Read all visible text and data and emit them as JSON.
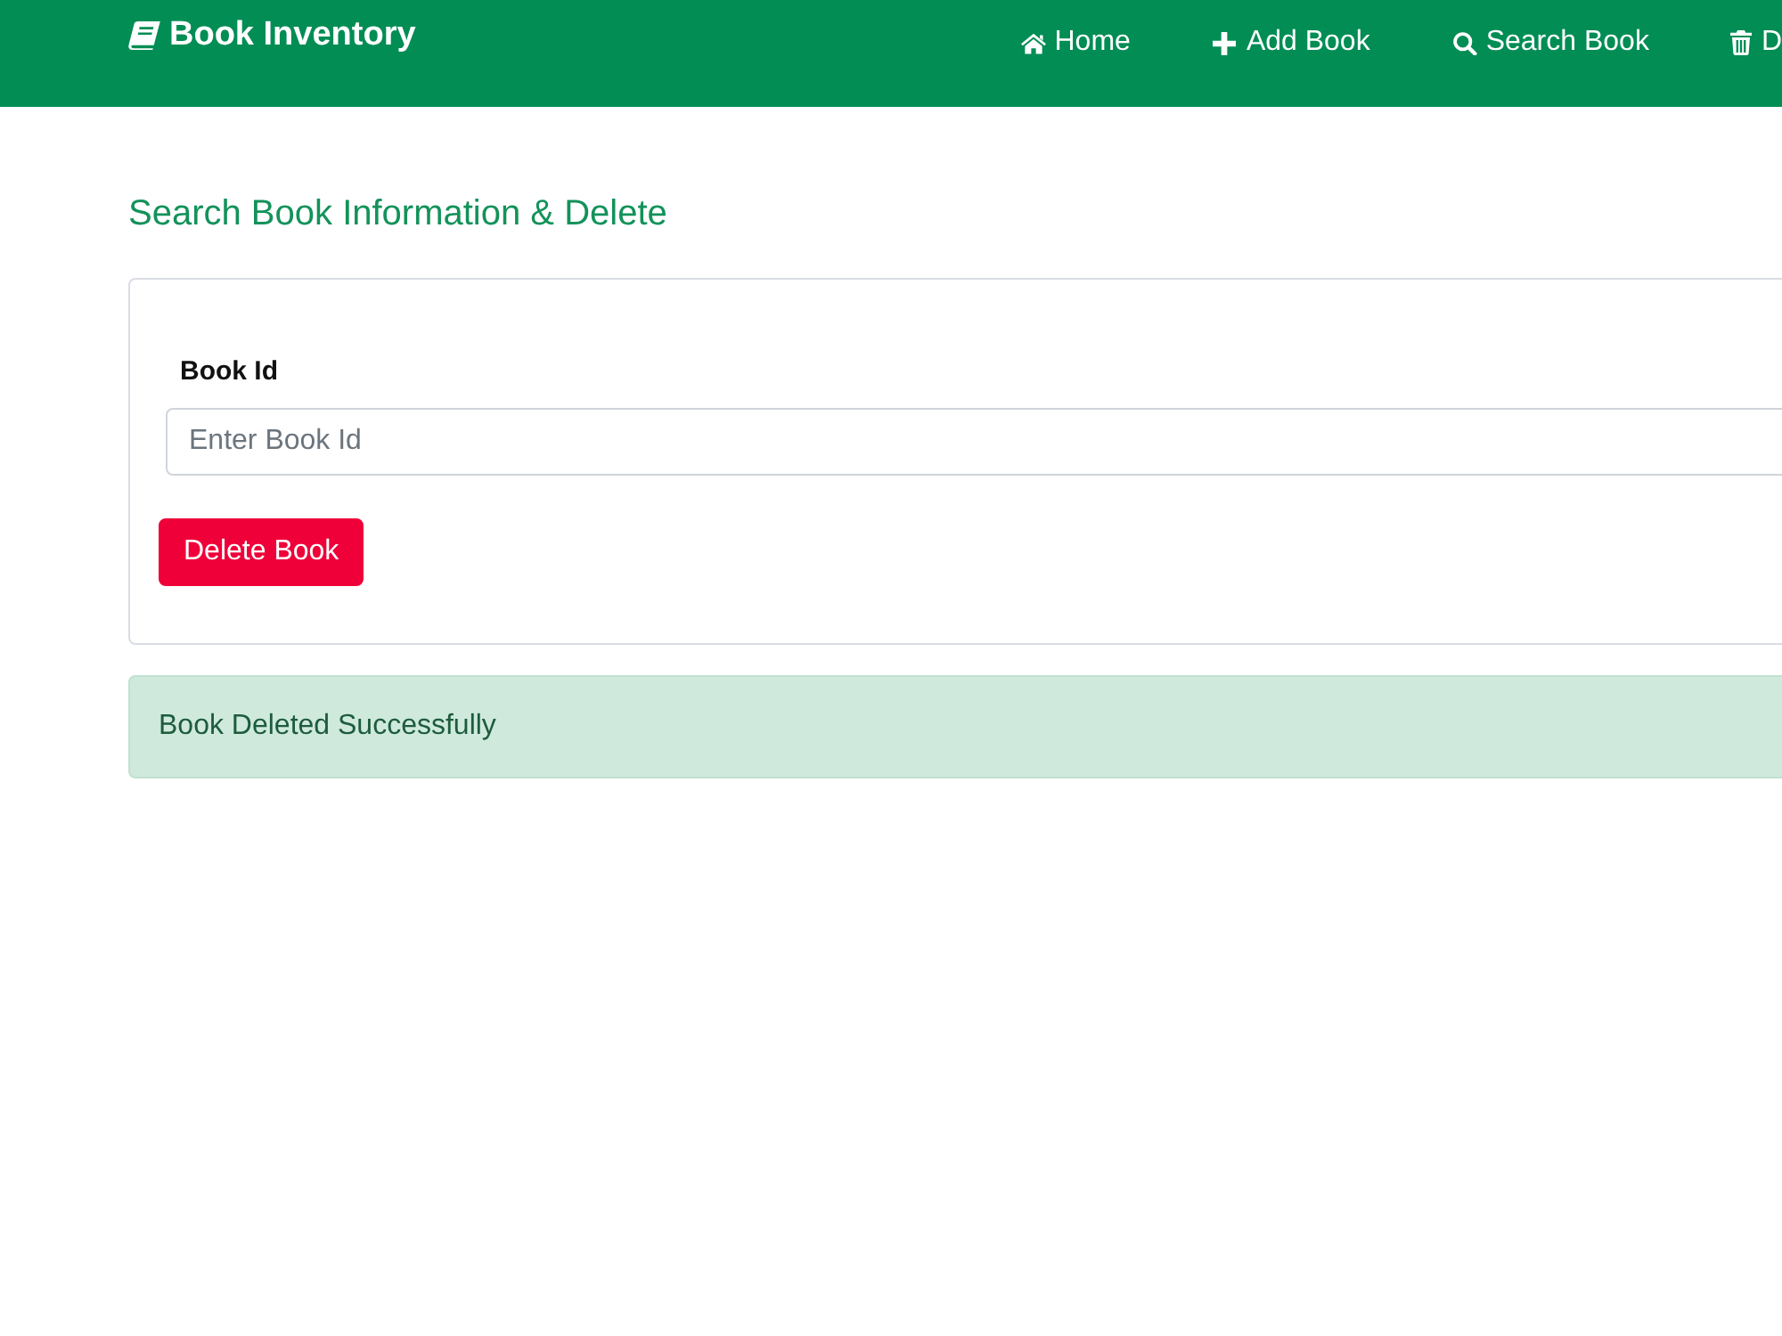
{
  "navbar": {
    "brand": "Book Inventory",
    "links": [
      {
        "kind": "home",
        "label": "Home"
      },
      {
        "kind": "add",
        "label": "Add Book"
      },
      {
        "kind": "search",
        "label": "Search Book"
      },
      {
        "kind": "delete",
        "label": "D"
      }
    ]
  },
  "heading": "Search Book Information & Delete",
  "form": {
    "label": "Book Id",
    "placeholder": "Enter Book Id",
    "button": "Delete Book"
  },
  "alert": {
    "kind": "success",
    "message": "Book Deleted Successfully"
  }
}
